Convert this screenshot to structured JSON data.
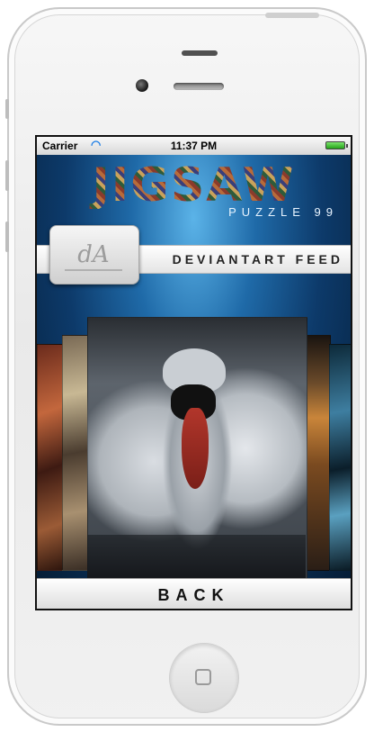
{
  "statusbar": {
    "carrier": "Carrier",
    "time": "11:37 PM",
    "wifi_icon": "wifi-icon",
    "battery_icon": "battery-icon"
  },
  "header": {
    "logo_text": "JIGSAW",
    "subtitle": "PUZZLE 99"
  },
  "feed": {
    "label": "DEVIANTART FEED",
    "button_icon": "deviantart-logo-icon",
    "button_glyph": "dA"
  },
  "footer": {
    "back_label": "BACK"
  },
  "colors": {
    "accent_blue": "#1f6aa8",
    "background_dark": "#051d36",
    "bar_white": "#ffffff"
  }
}
